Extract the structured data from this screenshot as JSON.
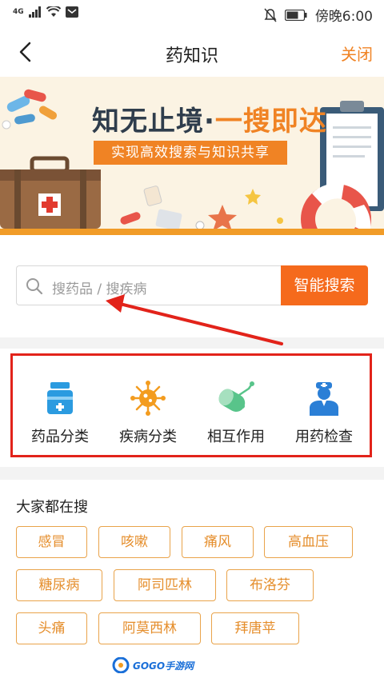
{
  "status_bar": {
    "network": "4G",
    "time": "傍晚6:00"
  },
  "nav": {
    "title": "药知识",
    "close_label": "关闭"
  },
  "banner": {
    "slogan_part1": "知无止境·",
    "slogan_part2": "一搜即达",
    "tagline": "实现高效搜索与知识共享"
  },
  "search": {
    "placeholder": "搜药品 / 搜疾病",
    "button_label": "智能搜索"
  },
  "categories": [
    {
      "label": "药品分类",
      "icon": "medicine-bottle-icon"
    },
    {
      "label": "疾病分类",
      "icon": "virus-icon"
    },
    {
      "label": "相互作用",
      "icon": "pill-interaction-icon"
    },
    {
      "label": "用药检查",
      "icon": "doctor-icon"
    }
  ],
  "popular": {
    "title": "大家都在搜",
    "tags": [
      "感冒",
      "咳嗽",
      "痛风",
      "高血压",
      "糖尿病",
      "阿司匹林",
      "布洛芬",
      "头痛",
      "阿莫西林",
      "拜唐苹"
    ]
  },
  "watermark": {
    "text": "GOGO手游网"
  },
  "colors": {
    "accent": "#f08324",
    "search_button": "#f56a1c",
    "highlight_frame": "#e2231a",
    "category_icon": "#2b9be0",
    "category_icon_alt": "#f39c1f",
    "interaction_icon": "#58c48a"
  }
}
